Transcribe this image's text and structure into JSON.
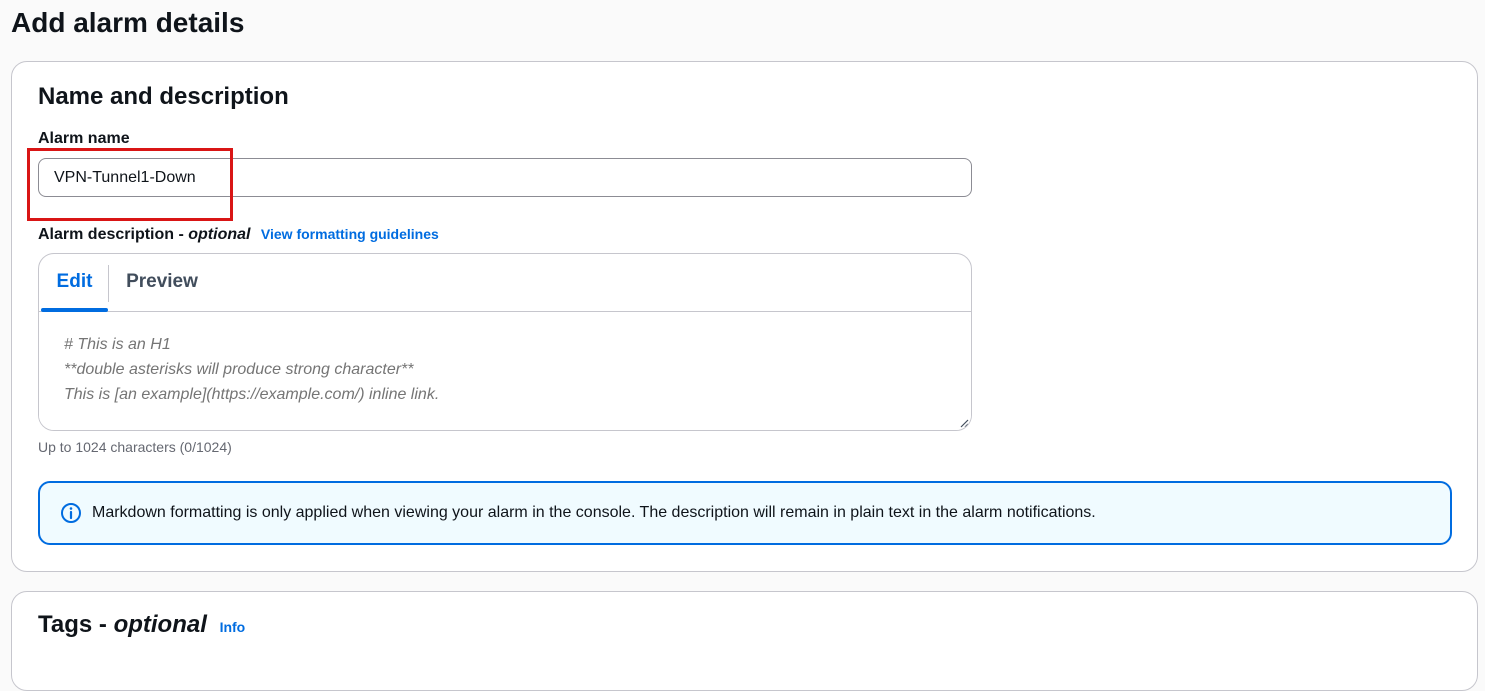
{
  "page": {
    "title": "Add alarm details"
  },
  "name_section": {
    "title": "Name and description",
    "alarm_name_label": "Alarm name",
    "alarm_name_value": "VPN-Tunnel1-Down",
    "description_label": "Alarm description - ",
    "description_optional": "optional",
    "formatting_link": "View formatting guidelines",
    "tabs": {
      "edit": "Edit",
      "preview": "Preview"
    },
    "description_placeholder": "# This is an H1\n**double asterisks will produce strong character**\nThis is [an example](https://example.com/) inline link.",
    "char_hint": "Up to 1024 characters (0/1024)",
    "alert_text": "Markdown formatting is only applied when viewing your alarm in the console. The description will remain in plain text in the alarm notifications.",
    "alert_icon": "info-icon"
  },
  "tags_section": {
    "title": "Tags - ",
    "title_optional": "optional",
    "info_link": "Info"
  },
  "colors": {
    "accent": "#006ce0",
    "highlight": "#d91515",
    "alert_bg": "#f0fbff"
  }
}
